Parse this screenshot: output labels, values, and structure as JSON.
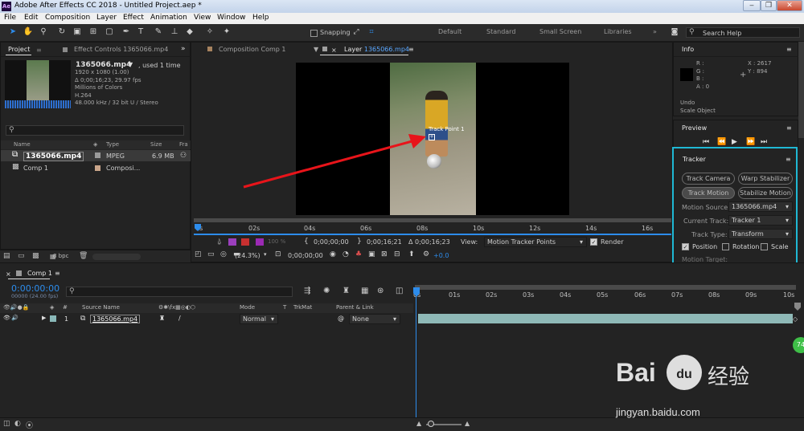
{
  "app": {
    "title": "Adobe After Effects CC 2018 - Untitled Project.aep *",
    "icon_text": "Ae"
  },
  "window_controls": {
    "minimize": "‒",
    "restore": "❒",
    "close": "✕"
  },
  "menu": [
    "File",
    "Edit",
    "Composition",
    "Layer",
    "Effect",
    "Animation",
    "View",
    "Window",
    "Help"
  ],
  "toolbar": {
    "snapping_label": "Snapping",
    "workspaces": [
      "Default",
      "Standard",
      "Small Screen",
      "Libraries"
    ],
    "search_placeholder": "Search Help"
  },
  "project_panel": {
    "tab_project": "Project",
    "tab_effect_controls": "Effect Controls 1365066.mp4",
    "file_name": "1365066.mp4",
    "used": ", used 1 time",
    "meta": [
      "1920 x 1080 (1.00)",
      "Δ 0;00;16;23, 29.97 fps",
      "Millions of Colors",
      "H.264",
      "48.000 kHz / 32 bit U / Stereo"
    ],
    "columns": [
      "Name",
      "Type",
      "Size",
      "Fra"
    ],
    "rows": [
      {
        "name": "1365066.mp4",
        "type": "MPEG",
        "size": "6.9 MB"
      },
      {
        "name": "Comp 1",
        "type": "Composi...",
        "size": ""
      }
    ],
    "bpc": "8 bpc"
  },
  "viewer": {
    "tab_comp": "Composition Comp 1",
    "tab_layer_prefix": "Layer",
    "tab_layer_name": "1365066.mp4",
    "track_point_label": "Track Point 1",
    "ruler_ticks": [
      "0s",
      "02s",
      "04s",
      "06s",
      "08s",
      "10s",
      "12s",
      "14s",
      "16s"
    ],
    "time_start": "0;00;00;00",
    "time_end": "0;00;16;21",
    "time_delta": "Δ 0;00;16;23",
    "view_label": "View:",
    "view_value": "Motion Tracker Points",
    "render_label": "Render",
    "zoom": "(24.3%)",
    "current_time": "0;00;00;00",
    "exposure": "+0.0",
    "opacity": "100 %"
  },
  "info_panel": {
    "title": "Info",
    "r": "R :",
    "g": "G :",
    "b": "B :",
    "a": "A :  0",
    "x": "X : 2617",
    "y": "Y : 894",
    "undo_label": "Undo",
    "undo_action": "Scale Object"
  },
  "preview_panel": {
    "title": "Preview"
  },
  "tracker_panel": {
    "title": "Tracker",
    "buttons": [
      "Track Camera",
      "Warp Stabilizer",
      "Track Motion",
      "Stabilize Motion"
    ],
    "motion_source_label": "Motion Source:",
    "motion_source_value": "1365066.mp4",
    "current_track_label": "Current Track:",
    "current_track_value": "Tracker 1",
    "track_type_label": "Track Type:",
    "track_type_value": "Transform",
    "position_label": "Position",
    "rotation_label": "Rotation",
    "scale_label": "Scale",
    "motion_target_label": "Motion Target:"
  },
  "timeline": {
    "tab": "Comp 1",
    "timecode": "0:00:00:00",
    "fps": "00000 (24.00 fps)",
    "ruler_ticks": [
      "0s",
      "01s",
      "02s",
      "03s",
      "04s",
      "05s",
      "06s",
      "07s",
      "08s",
      "09s",
      "10s"
    ],
    "headers": {
      "source_name": "Source Name",
      "mode": "Mode",
      "t": "T",
      "trkmat": "TrkMat",
      "parent": "Parent & Link"
    },
    "layer": {
      "index": "1",
      "name": "1365066.mp4",
      "mode": "Normal",
      "parent": "None"
    }
  },
  "watermark": {
    "brand": "Bai",
    "paw_text": "du",
    "cn": "经验",
    "url": "jingyan.baidu.com",
    "badge": "74"
  },
  "colors": {
    "accent": "#2d8ceb",
    "highlight_box": "#1fb8d4",
    "arrow": "#e8141a",
    "track_bar": "#8fb9b7"
  }
}
